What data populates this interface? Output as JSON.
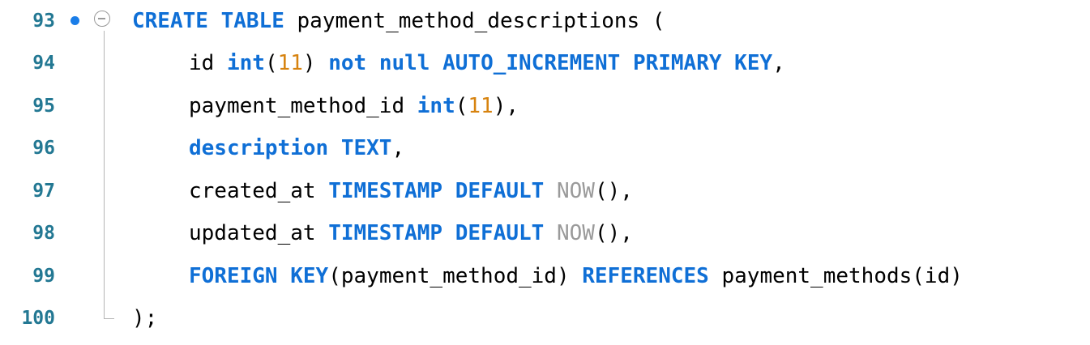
{
  "editor": {
    "lines": [
      {
        "number": "93",
        "tokens": [
          {
            "t": "CREATE",
            "c": "kw"
          },
          {
            "t": " ",
            "c": "plain"
          },
          {
            "t": "TABLE",
            "c": "kw"
          },
          {
            "t": " payment_method_descriptions (",
            "c": "plain"
          }
        ]
      },
      {
        "number": "94",
        "tokens": [
          {
            "t": "id ",
            "c": "plain"
          },
          {
            "t": "int",
            "c": "kw"
          },
          {
            "t": "(",
            "c": "plain"
          },
          {
            "t": "11",
            "c": "num"
          },
          {
            "t": ") ",
            "c": "plain"
          },
          {
            "t": "not",
            "c": "kw"
          },
          {
            "t": " ",
            "c": "plain"
          },
          {
            "t": "null",
            "c": "kw"
          },
          {
            "t": " ",
            "c": "plain"
          },
          {
            "t": "AUTO_INCREMENT",
            "c": "kw"
          },
          {
            "t": " ",
            "c": "plain"
          },
          {
            "t": "PRIMARY",
            "c": "kw"
          },
          {
            "t": " ",
            "c": "plain"
          },
          {
            "t": "KEY",
            "c": "kw"
          },
          {
            "t": ",",
            "c": "plain"
          }
        ]
      },
      {
        "number": "95",
        "tokens": [
          {
            "t": "payment_method_id ",
            "c": "plain"
          },
          {
            "t": "int",
            "c": "kw"
          },
          {
            "t": "(",
            "c": "plain"
          },
          {
            "t": "11",
            "c": "num"
          },
          {
            "t": "),",
            "c": "plain"
          }
        ]
      },
      {
        "number": "96",
        "tokens": [
          {
            "t": "description",
            "c": "kw"
          },
          {
            "t": " ",
            "c": "plain"
          },
          {
            "t": "TEXT",
            "c": "kw"
          },
          {
            "t": ",",
            "c": "plain"
          }
        ]
      },
      {
        "number": "97",
        "tokens": [
          {
            "t": "created_at ",
            "c": "plain"
          },
          {
            "t": "TIMESTAMP",
            "c": "kw"
          },
          {
            "t": " ",
            "c": "plain"
          },
          {
            "t": "DEFAULT",
            "c": "kw"
          },
          {
            "t": " ",
            "c": "plain"
          },
          {
            "t": "NOW",
            "c": "fn"
          },
          {
            "t": "(),",
            "c": "plain"
          }
        ]
      },
      {
        "number": "98",
        "tokens": [
          {
            "t": "updated_at ",
            "c": "plain"
          },
          {
            "t": "TIMESTAMP",
            "c": "kw"
          },
          {
            "t": " ",
            "c": "plain"
          },
          {
            "t": "DEFAULT",
            "c": "kw"
          },
          {
            "t": " ",
            "c": "plain"
          },
          {
            "t": "NOW",
            "c": "fn"
          },
          {
            "t": "(),",
            "c": "plain"
          }
        ]
      },
      {
        "number": "99",
        "tokens": [
          {
            "t": "FOREIGN",
            "c": "kw"
          },
          {
            "t": " ",
            "c": "plain"
          },
          {
            "t": "KEY",
            "c": "kw"
          },
          {
            "t": "(payment_method_id) ",
            "c": "plain"
          },
          {
            "t": "REFERENCES",
            "c": "kw"
          },
          {
            "t": " payment_methods(id)",
            "c": "plain"
          }
        ]
      },
      {
        "number": "100",
        "tokens": [
          {
            "t": ");",
            "c": "plain"
          }
        ]
      }
    ],
    "modified_dot_color": "#1a7de8",
    "keyword_color": "#0f6fd6",
    "number_color": "#d7830f",
    "function_color": "#9a9a9a",
    "line_number_color": "#237893"
  }
}
